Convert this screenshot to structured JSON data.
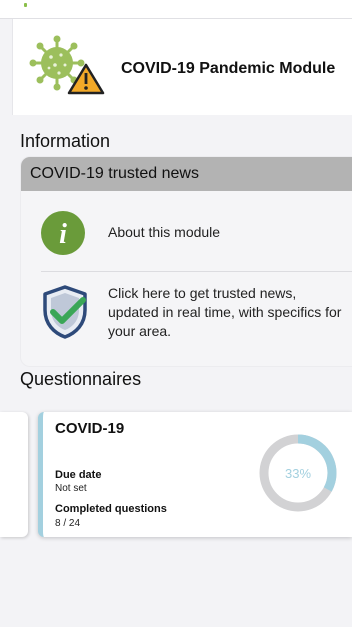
{
  "header": {
    "title": "COVID-19 Pandemic Module",
    "logo_icon": "virus-warning-icon"
  },
  "information": {
    "section_title": "Information",
    "news_card": {
      "title": "COVID-19 trusted news",
      "items": [
        {
          "icon": "info-circle-icon",
          "label": "About this module"
        },
        {
          "icon": "shield-check-icon",
          "label": "Click here to get trusted news, updated in real time, with specifics for your area."
        }
      ]
    }
  },
  "questionnaires": {
    "section_title": "Questionnaires",
    "cards": [
      {
        "name": "COVID-19",
        "due_label": "Due date",
        "due_value": "Not set",
        "completed_label": "Completed questions",
        "completed_value": "8 / 24",
        "progress_percent_label": "33%",
        "progress_fraction": 0.33
      }
    ]
  },
  "colors": {
    "accent": "#a3d0df",
    "info_green": "#6a9b3a",
    "band_gray": "#b3b3b3",
    "shield_navy": "#2e4a7a",
    "check_green": "#3aa657"
  }
}
